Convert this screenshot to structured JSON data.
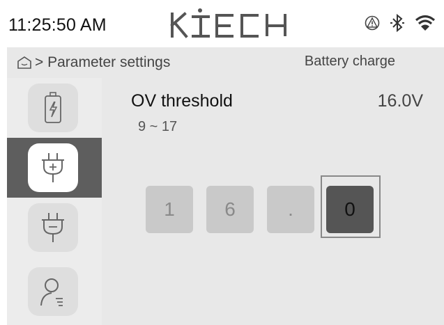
{
  "status_bar": {
    "time": "11:25:50 AM",
    "brand": "KTECH",
    "icons": [
      "warning-icon",
      "bluetooth-icon",
      "wifi-icon"
    ]
  },
  "breadcrumb": {
    "home_icon": "home-icon",
    "path": "> Parameter settings",
    "section": "Battery charge"
  },
  "sidebar": {
    "items": [
      {
        "icon": "battery-charging-icon",
        "active": false
      },
      {
        "icon": "plug-plus-icon",
        "active": true
      },
      {
        "icon": "plug-minus-icon",
        "active": false
      },
      {
        "icon": "user-settings-icon",
        "active": false
      }
    ]
  },
  "parameter": {
    "name": "OV threshold",
    "range": "9 ~ 17",
    "value": "16.0V"
  },
  "digit_entry": {
    "digits": [
      "1",
      "6",
      ".",
      "0"
    ],
    "selected_index": 3
  },
  "colors": {
    "active_bg": "#5e5e5e",
    "panel_bg": "#e8e8e8",
    "digit_bg": "#c9c9c9",
    "digit_selected_bg": "#555555"
  }
}
